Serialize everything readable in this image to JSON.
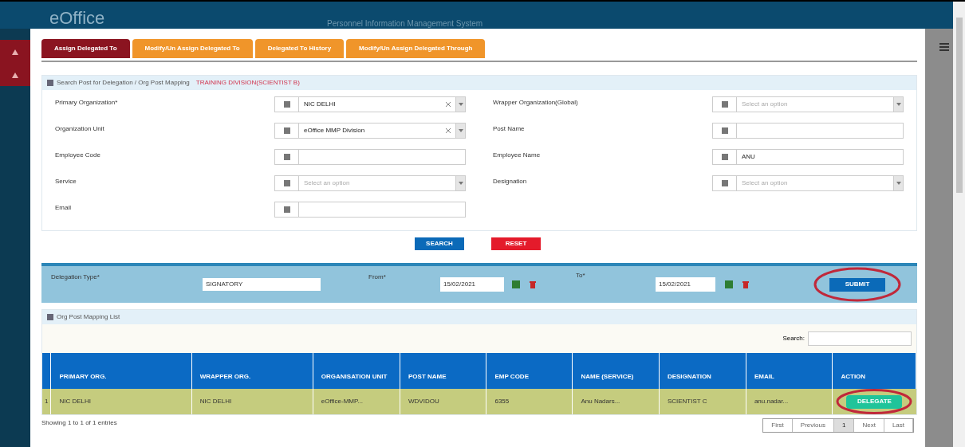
{
  "app": {
    "logo": "eOffice",
    "title": "Personnel Information Management System"
  },
  "tabs": [
    {
      "label": "Assign Delegated To",
      "selected": true
    },
    {
      "label": "Modify/Un Assign Delegated To",
      "selected": false
    },
    {
      "label": "Delegated To History",
      "selected": false
    },
    {
      "label": "Modify/Un Assign Delegated Through",
      "selected": false
    }
  ],
  "search_panel": {
    "title": "Search Post for Delegation / Org Post Mapping",
    "context": "TRAINING DIVISION(SCIENTIST B)",
    "fields": [
      {
        "label": "Primary Organization*",
        "kind": "select",
        "value": "NIC DELHI",
        "clearable": true
      },
      {
        "label": "Wrapper Organization(Global)",
        "kind": "select",
        "placeholder": "Select an option",
        "clearable": false
      },
      {
        "label": "Organization Unit",
        "kind": "select",
        "value": "eOffice MMP Division",
        "clearable": true
      },
      {
        "label": "Post Name",
        "kind": "text"
      },
      {
        "label": "Employee Code",
        "kind": "text"
      },
      {
        "label": "Employee Name",
        "kind": "text",
        "value": "ANU"
      },
      {
        "label": "Service",
        "kind": "select",
        "placeholder": "Select an option",
        "clearable": false
      },
      {
        "label": "Designation",
        "kind": "select",
        "placeholder": "Select an option",
        "clearable": false
      },
      {
        "label": "Email",
        "kind": "text"
      }
    ],
    "buttons": [
      {
        "label": "SEARCH",
        "kind": "primary"
      },
      {
        "label": "RESET",
        "kind": "danger"
      }
    ]
  },
  "delegation": {
    "type_label": "Delegation Type*",
    "type_value": "SIGNATORY",
    "from_label": "From*",
    "from_value": "15/02/2021",
    "to_label": "To*",
    "to_value": "15/02/2021",
    "submit": {
      "label": "SUBMIT",
      "circled": true
    }
  },
  "list_panel": {
    "title": "Org Post Mapping List",
    "search_label": "Search:",
    "columns": [
      "PRIMARY ORG.",
      "WRAPPER ORG.",
      "ORGANISATION UNIT",
      "POST NAME",
      "EMP CODE",
      "NAME (SERVICE)",
      "DESIGNATION",
      "EMAIL",
      "ACTION"
    ],
    "rows": [
      {
        "index": "1",
        "cells": [
          "NIC DELHI",
          "NIC DELHI",
          "eOffice-MMP...",
          "WDVIDOU",
          "6355",
          "Anu Nadars...",
          "SCIENTIST C",
          "anu.nadar..."
        ],
        "action": {
          "label": "DELEGATE",
          "circled": true
        }
      }
    ],
    "info": "Showing 1 to 1 of 1 entries",
    "pagination": [
      {
        "label": "First",
        "selected": false
      },
      {
        "label": "Previous",
        "selected": false
      },
      {
        "label": "1",
        "selected": true
      },
      {
        "label": "Next",
        "selected": false
      },
      {
        "label": "Last",
        "selected": false
      }
    ]
  }
}
